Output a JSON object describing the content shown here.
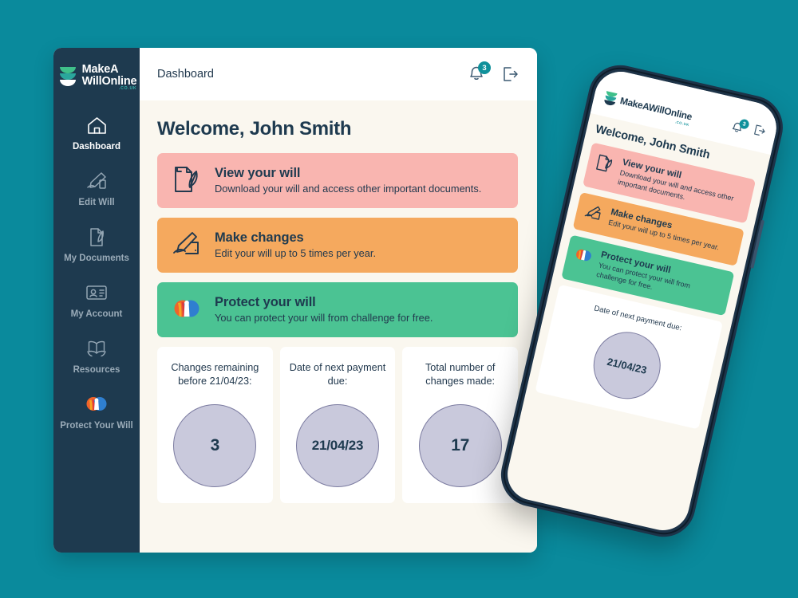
{
  "theme": {
    "page_background": "#0a8a9c",
    "sidebar_background": "#1e3a4f",
    "content_background": "#faf7ef",
    "accent_teal": "#10919b",
    "card_pink": "#f9b5b0",
    "card_orange": "#f5a95e",
    "card_green": "#4bc393",
    "circle_fill": "#c9c9dc",
    "circle_border": "#7b7ba0",
    "text_dark": "#1e3a4f"
  },
  "brand": {
    "name_line1": "MakeA",
    "name_line2": "WillOnline",
    "suffix": ".CO.UK",
    "name_inline": "MakeAWillOnline",
    "logo_icon": "stacked-bowls-logo-icon"
  },
  "sidebar": {
    "items": [
      {
        "label": "Dashboard",
        "icon": "home-icon",
        "active": true
      },
      {
        "label": "Edit Will",
        "icon": "hand-writing-icon",
        "active": false
      },
      {
        "label": "My Documents",
        "icon": "document-quill-icon",
        "active": false
      },
      {
        "label": "My Account",
        "icon": "id-card-icon",
        "active": false
      },
      {
        "label": "Resources",
        "icon": "open-book-icon",
        "active": false
      },
      {
        "label": "Protect Your Will",
        "icon": "protect-shield-people-icon",
        "active": false
      }
    ]
  },
  "topbar": {
    "breadcrumb": "Dashboard",
    "notification_icon": "bell-icon",
    "notification_count": "3",
    "logout_icon": "logout-arrow-icon"
  },
  "main": {
    "welcome_title": "Welcome, John Smith",
    "action_cards": [
      {
        "title": "View your will",
        "subtitle": "Download your will and access other important documents.",
        "color": "#f9b5b0",
        "icon": "document-quill-icon"
      },
      {
        "title": "Make changes",
        "subtitle": "Edit your will up to 5 times per year.",
        "color": "#f5a95e",
        "icon": "hand-writing-icon"
      },
      {
        "title": "Protect your will",
        "subtitle": "You can protect your will  from challenge for free.",
        "color": "#4bc393",
        "icon": "protect-shield-people-icon"
      }
    ],
    "stats": [
      {
        "label": "Changes remaining before 21/04/23:",
        "value": "3",
        "value_size": "large"
      },
      {
        "label": "Date of next payment due:",
        "value": "21/04/23",
        "value_size": "small"
      },
      {
        "label": "Total number of changes made:",
        "value": "17",
        "value_size": "large"
      }
    ]
  },
  "phone": {
    "welcome_title": "Welcome, John Smith",
    "notification_count": "3",
    "action_cards": [
      {
        "title": "View your will",
        "subtitle": "Download your will and access other important documents."
      },
      {
        "title": "Make changes",
        "subtitle": "Edit your will up to 5 times per year."
      },
      {
        "title": "Protect your will",
        "subtitle": "You can protect your will  from challenge for free."
      }
    ],
    "stat": {
      "label": "Date of next payment due:",
      "value": "21/04/23"
    }
  }
}
